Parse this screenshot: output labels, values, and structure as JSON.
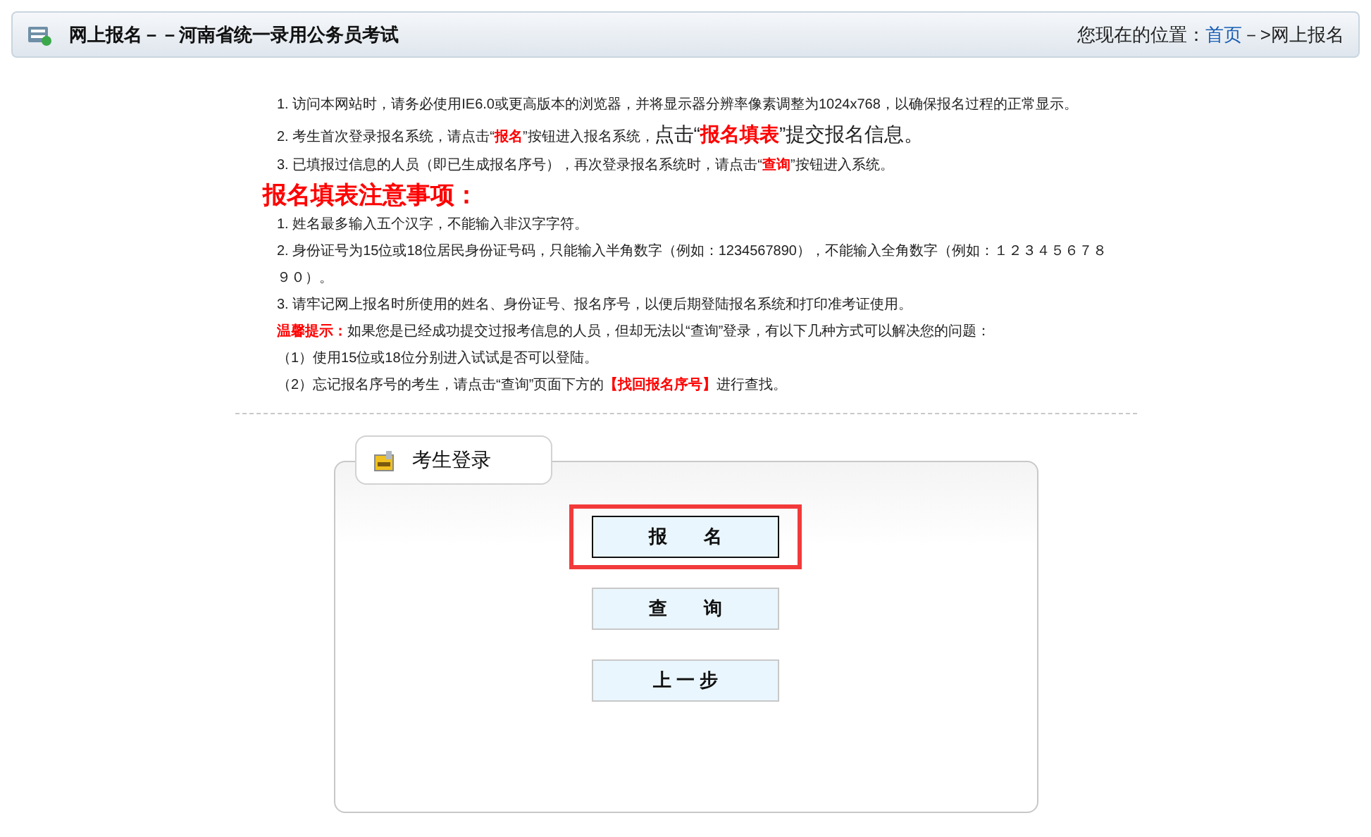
{
  "header": {
    "title": "网上报名－－河南省统一录用公务员考试",
    "location_label": "您现在的位置：",
    "breadcrumb": [
      {
        "label": "首页",
        "link": true
      },
      {
        "label": "－>网上报名",
        "link": false
      }
    ]
  },
  "instructions": [
    {
      "text": "1. 访问本网站时，请务必使用IE6.0或更高版本的浏览器，并将显示器分辨率像素调整为1024x768，以确保报名过程的正常显示。"
    },
    {
      "text": "2. 考生首次登录报名系统，请点击“**报名**”按钮进入报名系统，",
      "big": "点击“**报名填表**”提交报名信息。"
    },
    {
      "text": "3. 已填报过信息的人员（即已生成报名序号），再次登录报名系统时，请点击“**查询**”按钮进入系统。"
    }
  ],
  "notice_title": "报名填表注意事项：",
  "notices": [
    "1. 姓名最多输入五个汉字，不能输入非汉字字符。",
    "2. 身份证号为15位或18位居民身份证号码，只能输入半角数字（例如：1234567890），不能输入全角数字（例如：１２３４５６７８９０）。",
    "3. 请牢记网上报名时所使用的姓名、身份证号、报名序号，以便后期登陆报名系统和打印准考证使用。",
    "**温馨提示：**如果您是已经成功提交过报考信息的人员，但却无法以“查询”登录，有以下几种方式可以解决您的问题：",
    "（1）使用15位或18位分别进入试试是否可以登陆。",
    "（2）忘记报名序号的考生，请点击“查询”页面下方的**【找回报名序号】**进行查找。"
  ],
  "login_panel": {
    "title": "考生登录",
    "buttons": [
      {
        "label": "报　　名",
        "selected": true,
        "highlighted": true
      },
      {
        "label": "查　　询",
        "selected": false,
        "highlighted": false
      },
      {
        "label": "上 一 步",
        "selected": false,
        "highlighted": false
      }
    ]
  }
}
